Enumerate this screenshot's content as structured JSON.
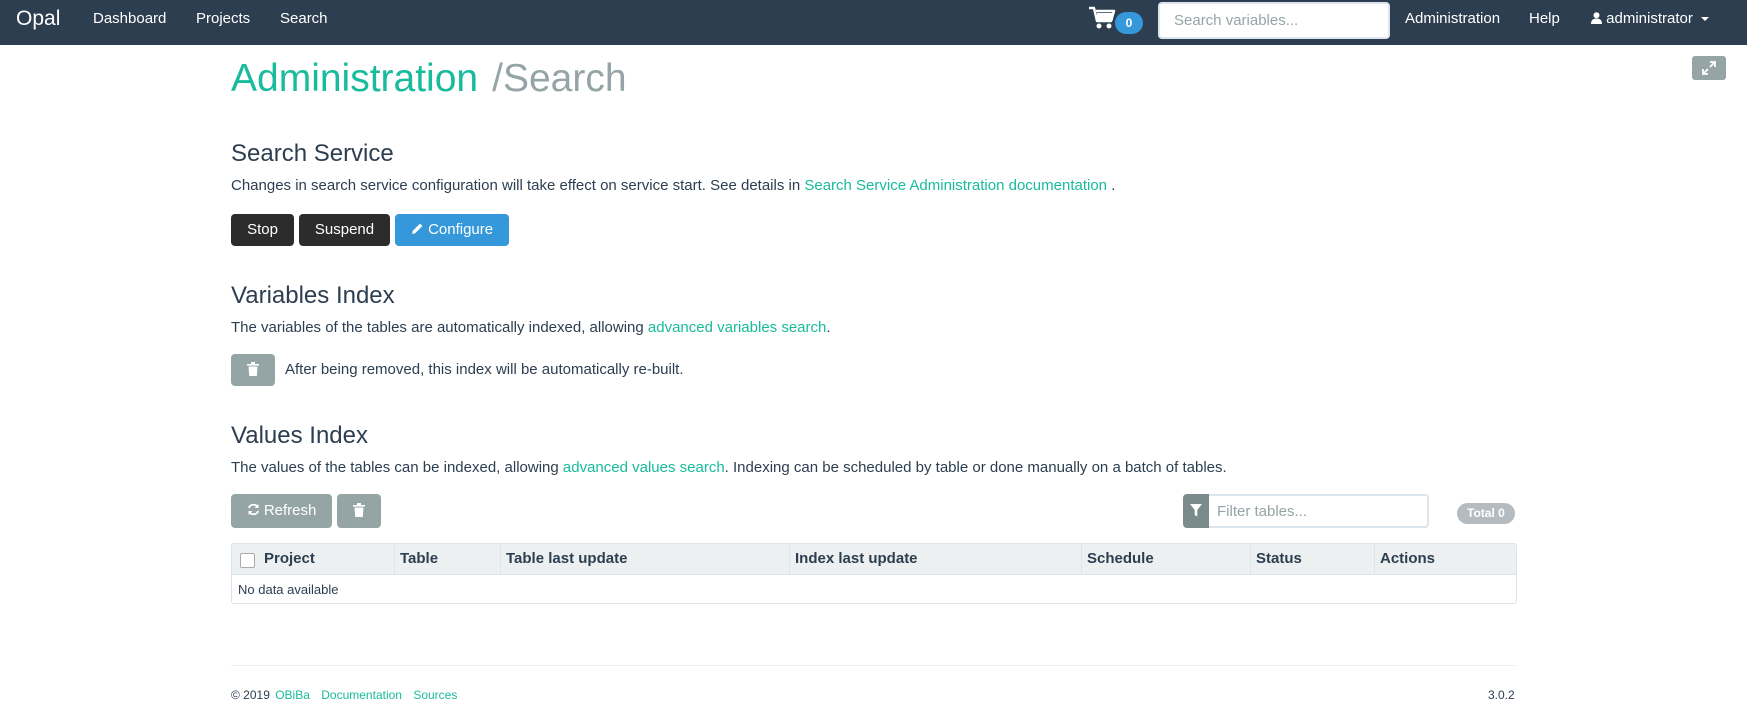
{
  "navbar": {
    "brand": "Opal",
    "links": [
      "Dashboard",
      "Projects",
      "Search"
    ],
    "cart_count": "0",
    "search_placeholder": "Search variables...",
    "right_links": [
      "Administration",
      "Help"
    ],
    "user": "administrator"
  },
  "page": {
    "title": "Administration",
    "separator": "/",
    "subtitle": "Search"
  },
  "search_service": {
    "heading": "Search Service",
    "text": "Changes in search service configuration will take effect on service start. See details in ",
    "link": "Search Service Administration documentation",
    "text_end": " .",
    "buttons": {
      "stop": "Stop",
      "suspend": "Suspend",
      "configure": "Configure"
    }
  },
  "variables_index": {
    "heading": "Variables Index",
    "text": "The variables of the tables are automatically indexed, allowing ",
    "link": "advanced variables search",
    "text_end": ".",
    "note": "After being removed, this index will be automatically re-built."
  },
  "values_index": {
    "heading": "Values Index",
    "text": "The values of the tables can be indexed, allowing ",
    "link": "advanced values search",
    "text_end": ". Indexing can be scheduled by table or done manually on a batch of tables.",
    "refresh": "Refresh",
    "filter_placeholder": "Filter tables...",
    "total": "Total 0",
    "table": {
      "columns": [
        "Project",
        "Table",
        "Table last update",
        "Index last update",
        "Schedule",
        "Status",
        "Actions"
      ],
      "empty": "No data available"
    }
  },
  "footer": {
    "copyright": "© 2019",
    "links": [
      "OBiBa",
      "Documentation",
      "Sources"
    ],
    "version": "3.0.2"
  },
  "colors": {
    "navbar": "#2c3e50",
    "accent": "#18bc9c",
    "primary": "#3498db",
    "gray": "#95a5a6",
    "dark_button": "#2c2c2c"
  }
}
